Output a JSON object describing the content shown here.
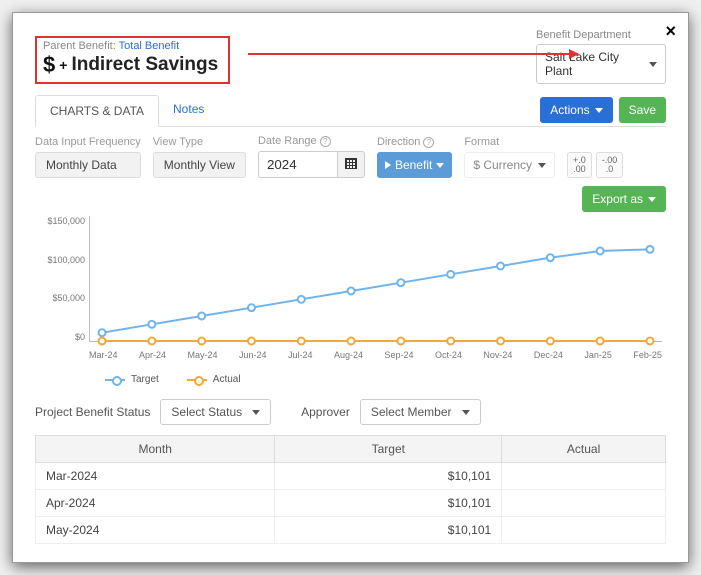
{
  "header": {
    "parent_label": "Parent Benefit:",
    "parent_link": "Total Benefit",
    "icon_text": "$",
    "plus": "+",
    "title": "Indirect Savings"
  },
  "dept": {
    "label": "Benefit Department",
    "value": "Salt Lake City Plant"
  },
  "tabs": {
    "charts": "CHARTS & DATA",
    "notes": "Notes",
    "actions": "Actions",
    "save": "Save"
  },
  "filters": {
    "freq_label": "Data Input Frequency",
    "freq_value": "Monthly Data",
    "view_label": "View Type",
    "view_value": "Monthly View",
    "date_label": "Date Range",
    "date_value": "2024",
    "dir_label": "Direction",
    "dir_value": "Benefit",
    "fmt_label": "Format",
    "fmt_value": "$ Currency",
    "dec_inc": "+.0\n.00",
    "dec_dec": "-.00\n.0"
  },
  "export_label": "Export as",
  "legend": {
    "target": "Target",
    "actual": "Actual"
  },
  "status": {
    "pbs_label": "Project Benefit Status",
    "pbs_value": "Select Status",
    "app_label": "Approver",
    "app_value": "Select Member"
  },
  "table": {
    "head_month": "Month",
    "head_target": "Target",
    "head_actual": "Actual",
    "rows": [
      {
        "month": "Mar-2024",
        "target": "$10,101",
        "actual": ""
      },
      {
        "month": "Apr-2024",
        "target": "$10,101",
        "actual": ""
      },
      {
        "month": "May-2024",
        "target": "$10,101",
        "actual": ""
      }
    ]
  },
  "chart_data": {
    "type": "line",
    "title": "",
    "xlabel": "",
    "ylabel": "",
    "ylim": [
      0,
      150000
    ],
    "yticks": [
      "$150,000",
      "$100,000",
      "$50,000",
      "$0"
    ],
    "categories": [
      "Mar-24",
      "Apr-24",
      "May-24",
      "Jun-24",
      "Jul-24",
      "Aug-24",
      "Sep-24",
      "Oct-24",
      "Nov-24",
      "Dec-24",
      "Jan-25",
      "Feb-25"
    ],
    "series": [
      {
        "name": "Target",
        "color": "#6fb4ec",
        "values": [
          10000,
          20000,
          30000,
          40000,
          50000,
          60000,
          70000,
          80000,
          90000,
          100000,
          108000,
          110000
        ]
      },
      {
        "name": "Actual",
        "color": "#f4a836",
        "values": [
          0,
          0,
          0,
          0,
          0,
          0,
          0,
          0,
          0,
          0,
          0,
          0
        ]
      }
    ]
  }
}
